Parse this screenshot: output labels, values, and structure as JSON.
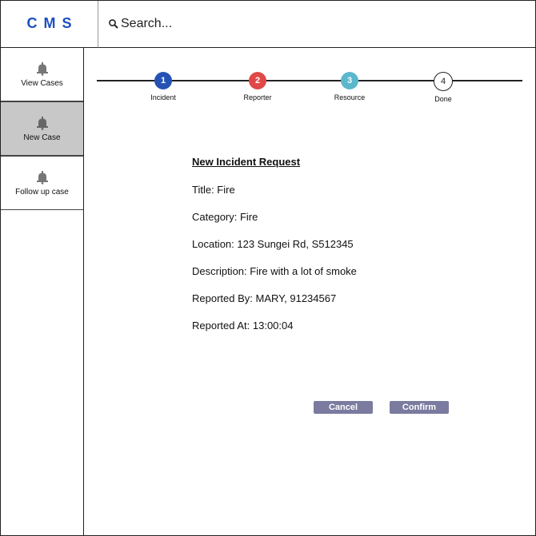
{
  "logo": "CMS",
  "search": {
    "placeholder": "Search..."
  },
  "sidebar": {
    "items": [
      {
        "label": "View Cases",
        "icon": "bell-icon"
      },
      {
        "label": "New Case",
        "icon": "bell-icon",
        "active": true
      },
      {
        "label": "Follow up case",
        "icon": "bell-icon"
      }
    ]
  },
  "steps": [
    {
      "number": "1",
      "label": "Incident",
      "color": "#2652b4"
    },
    {
      "number": "2",
      "label": "Reporter",
      "color": "#e04848"
    },
    {
      "number": "3",
      "label": "Resource",
      "color": "#5bb7cc"
    },
    {
      "number": "4",
      "label": "Done",
      "color": "#ffffff"
    }
  ],
  "form": {
    "title": "New Incident Request",
    "rows": [
      "Title: Fire",
      "Category: Fire",
      "Location: 123 Sungei Rd, S512345",
      "Description: Fire with a lot of smoke",
      "Reported By: MARY, 91234567",
      "Reported At: 13:00:04"
    ]
  },
  "buttons": {
    "cancel": "Cancel",
    "confirm": "Confirm"
  },
  "colors": {
    "brand": "#1c4fbf",
    "button": "#7b7ba0",
    "active_nav": "#c8c8c8"
  }
}
